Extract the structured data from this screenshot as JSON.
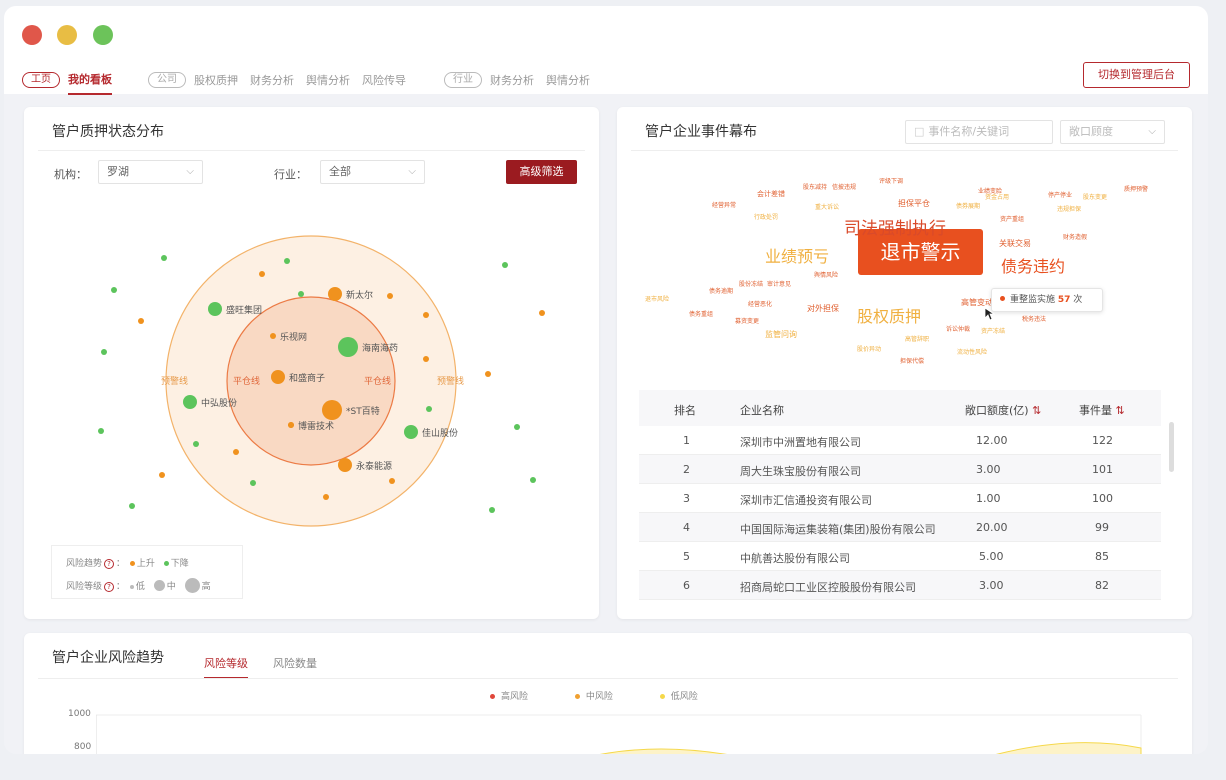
{
  "nav": {
    "home_pill": "工页",
    "my_board": "我的看板",
    "company_pill": "公司",
    "company_items": [
      "股权质押",
      "财务分析",
      "舆情分析",
      "风险传导"
    ],
    "industry_pill": "行业",
    "industry_items": [
      "财务分析",
      "舆情分析"
    ],
    "switch_button": "切换到管理后台"
  },
  "pledge_card": {
    "title": "管户质押状态分布",
    "org_label": "机构：",
    "org_value": "罗湖",
    "industry_label": "行业：",
    "industry_value": "全部",
    "filter_button": "高级筛选",
    "zone_labels": [
      "预警线",
      "平仓线",
      "平仓线",
      "预警线"
    ],
    "companies": [
      {
        "name": "新太尔",
        "trend": "up"
      },
      {
        "name": "盛旺集团",
        "trend": "down"
      },
      {
        "name": "乐视网",
        "trend": "up"
      },
      {
        "name": "海南海药",
        "trend": "down"
      },
      {
        "name": "和盛商子",
        "trend": "up"
      },
      {
        "name": "中弘股份",
        "trend": "down"
      },
      {
        "name": "*ST百特",
        "trend": "up"
      },
      {
        "name": "博雷技术",
        "trend": "up"
      },
      {
        "name": "佳山股份",
        "trend": "down"
      },
      {
        "name": "永泰能源",
        "trend": "up"
      }
    ],
    "legend": {
      "trend_label": "风险趋势",
      "up": "上升",
      "down": "下降",
      "level_label": "风险等级",
      "low": "低",
      "mid": "中",
      "high": "高"
    }
  },
  "event_card": {
    "title": "管户企业事件幕布",
    "search_placeholder": "事件名称/关键词",
    "select_placeholder": "敞口顾度",
    "highlight_word": "退市警示",
    "words": [
      "司法强制执行",
      "业绩预亏",
      "债务违约",
      "股权质押",
      "会计差错",
      "关联交易",
      "担保平仓",
      "对外担保",
      "高管变动",
      "监管问询",
      "诉讼仲裁",
      "资产冻结",
      "股东减持",
      "信披违规",
      "评级下调",
      "经营异常",
      "重大诉讼",
      "行政处罚",
      "债券展期",
      "业绩变脸",
      "资金占用",
      "停产停业",
      "股东变更",
      "质押预警",
      "违规担保",
      "资产重组",
      "财务造假",
      "舆情风险",
      "债务逾期",
      "股份冻结",
      "审计意见",
      "退市风险",
      "债务重组",
      "经营恶化",
      "募资变更",
      "税务违法",
      "高管辞职",
      "股价异动",
      "担保代偿",
      "流动性风险"
    ],
    "tooltip": {
      "label": "重整监实施",
      "value": "57",
      "unit": "次"
    },
    "table": {
      "headers": [
        "排名",
        "企业名称",
        "敞口额度(亿)",
        "事件量"
      ],
      "rows": [
        [
          "1",
          "深圳市中洲置地有限公司",
          "12.00",
          "122"
        ],
        [
          "2",
          "周大生珠宝股份有限公司",
          "3.00",
          "101"
        ],
        [
          "3",
          "深圳市汇信通投资有限公司",
          "1.00",
          "100"
        ],
        [
          "4",
          "中国国际海运集装箱(集团)股份有限公司",
          "20.00",
          "99"
        ],
        [
          "5",
          "中航善达股份有限公司",
          "5.00",
          "85"
        ],
        [
          "6",
          "招商局蛇口工业区控股股份有限公司",
          "3.00",
          "82"
        ]
      ]
    }
  },
  "trend_card": {
    "title": "管户企业风险趋势",
    "tabs": [
      "风险等级",
      "风险数量"
    ],
    "legend": [
      "高风险",
      "中风险",
      "低风险"
    ],
    "y_ticks": [
      "1000",
      "800"
    ]
  },
  "colors": {
    "brand": "#b5292e",
    "up": "#f0921e",
    "down": "#5cc45c",
    "high": "#e0473a",
    "mid": "#f0a030",
    "low": "#f5d84a"
  }
}
